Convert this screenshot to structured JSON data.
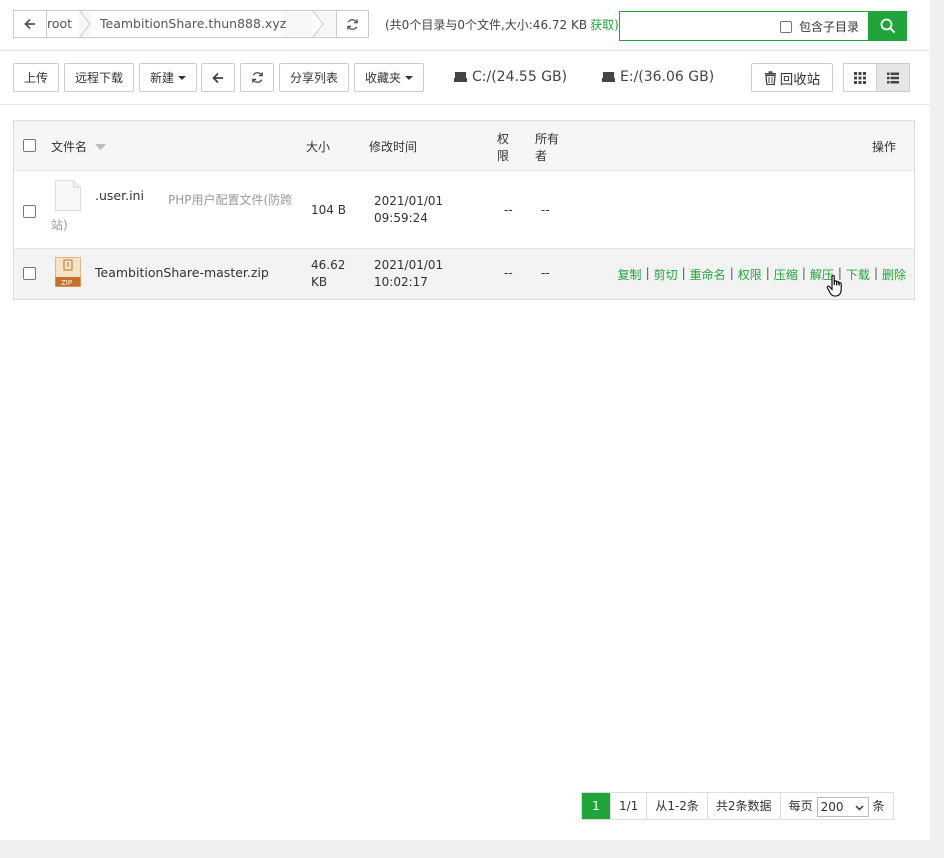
{
  "path": {
    "root": "root",
    "site": "TeambitionShare.thun888.xyz"
  },
  "summary": {
    "text": "(共0个目录与0个文件,大小:46.72 KB",
    "fetch": "获取)"
  },
  "search": {
    "placeholder": "",
    "include_subdir": "包含子目录"
  },
  "toolbar": {
    "upload": "上传",
    "remote_download": "远程下载",
    "new": "新建",
    "share_list": "分享列表",
    "favorites": "收藏夹",
    "recycle": "回收站"
  },
  "disks": [
    {
      "label": "C:/(24.55 GB)"
    },
    {
      "label": "E:/(36.06 GB)"
    }
  ],
  "table": {
    "headers": {
      "name": "文件名",
      "size": "大小",
      "mtime": "修改时间",
      "perm_1": "权",
      "perm_2": "限",
      "owner_1": "所有",
      "owner_2": "者",
      "ops": "操作"
    },
    "rows": [
      {
        "name": ".user.ini",
        "note_1": "PHP用户配置文件(防跨",
        "note_2": "站)",
        "size": "104 B",
        "date": "2021/01/01",
        "time": "09:59:24",
        "perm": "--",
        "owner": "--"
      },
      {
        "name": "TeambitionShare-master.zip",
        "icon_label": "ZIP",
        "size_1": "46.62",
        "size_2": "KB",
        "date": "2021/01/01",
        "time": "10:02:17",
        "perm": "--",
        "owner": "--",
        "ops": [
          "复制",
          "剪切",
          "重命名",
          "权限",
          "压缩",
          "解压",
          "下载",
          "删除"
        ]
      }
    ]
  },
  "pager": {
    "current": "1",
    "pages": "1/1",
    "range": "从1-2条",
    "total": "共2条数据",
    "per_page_label": "每页",
    "per_page": "200",
    "unit": "条"
  },
  "colors": {
    "accent": "#20a53a"
  }
}
